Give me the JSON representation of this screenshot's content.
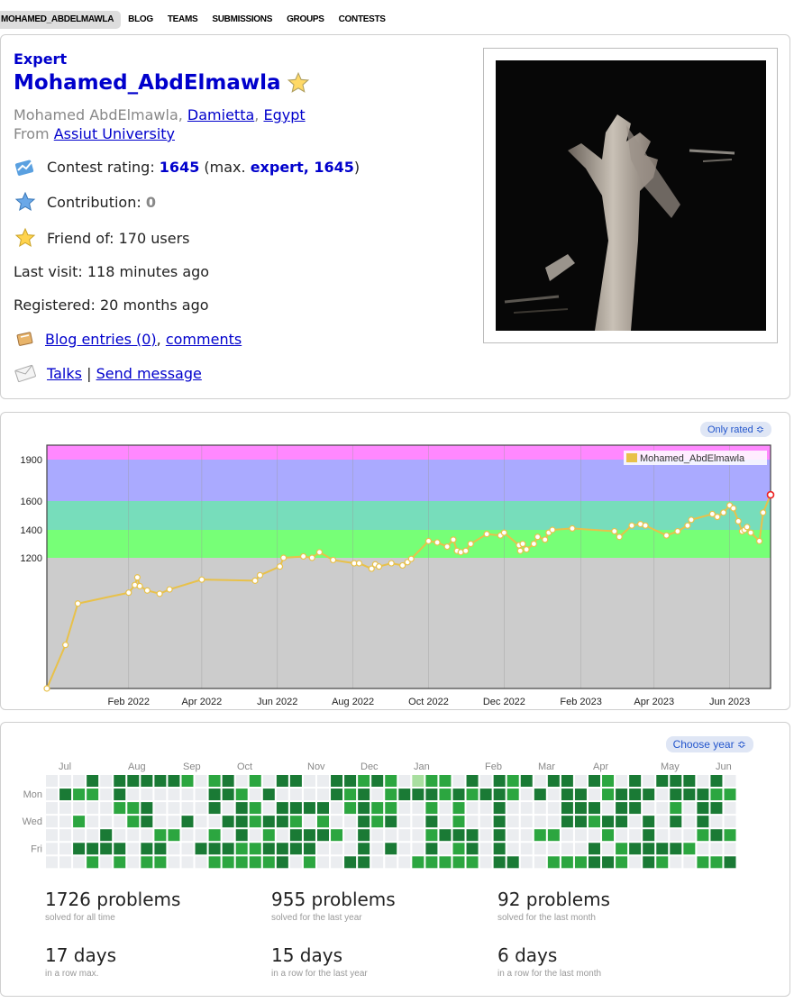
{
  "nav": {
    "items": [
      "MOHAMED_ABDELMAWLA",
      "BLOG",
      "TEAMS",
      "SUBMISSIONS",
      "GROUPS",
      "CONTESTS"
    ]
  },
  "profile": {
    "rank": "Expert",
    "handle": "Mohamed_AbdElmawla",
    "full_name": "Mohamed AbdElmawla",
    "city": "Damietta",
    "country": "Egypt",
    "from_label": "From",
    "organization": "Assiut University",
    "contest_rating_label": "Contest rating:",
    "contest_rating": "1645",
    "max_open": "(max.",
    "max_rank_value": "expert, 1645",
    "max_close": ")",
    "contribution_label": "Contribution:",
    "contribution": "0",
    "friend_of": "Friend of: 170 users",
    "last_visit": "Last visit: 118 minutes ago",
    "registered": "Registered: 20 months ago",
    "blog_entries": "Blog entries (0)",
    "comments": "comments",
    "talks": "Talks",
    "separator": "|",
    "send_message": "Send message"
  },
  "rating_graph": {
    "toggle_label": "Only rated ≎",
    "legend": "Mohamed_AbdElmawla"
  },
  "chart_data": {
    "type": "line",
    "title": "",
    "xlabel": "",
    "ylabel": "",
    "x_ticks": [
      "Feb 2022",
      "Apr 2022",
      "Jun 2022",
      "Aug 2022",
      "Oct 2022",
      "Dec 2022",
      "Feb 2023",
      "Apr 2023",
      "Jun 2023"
    ],
    "y_ticks": [
      1200,
      1400,
      1600,
      1900
    ],
    "ylim": [
      0,
      2000
    ],
    "bands": [
      {
        "from": 0,
        "to": 1200,
        "color": "#cccccc"
      },
      {
        "from": 1200,
        "to": 1400,
        "color": "#77ff77"
      },
      {
        "from": 1400,
        "to": 1600,
        "color": "#77ddbb"
      },
      {
        "from": 1600,
        "to": 1900,
        "color": "#aaaaff"
      },
      {
        "from": 1900,
        "to": 2000,
        "color": "#ff88ff"
      }
    ],
    "line_color": "#e8c14a",
    "series": [
      {
        "name": "Mohamed_AbdElmawla",
        "x": [
          "2021-11-27",
          "2021-12-12",
          "2021-12-22",
          "2022-02-01",
          "2022-02-06",
          "2022-02-08",
          "2022-02-10",
          "2022-02-16",
          "2022-02-26",
          "2022-03-06",
          "2022-04-01",
          "2022-05-14",
          "2022-05-18",
          "2022-06-03",
          "2022-06-06",
          "2022-06-22",
          "2022-06-29",
          "2022-07-05",
          "2022-07-16",
          "2022-08-02",
          "2022-08-06",
          "2022-08-16",
          "2022-08-19",
          "2022-08-22",
          "2022-09-01",
          "2022-09-10",
          "2022-09-14",
          "2022-09-17",
          "2022-10-01",
          "2022-10-08",
          "2022-10-16",
          "2022-10-21",
          "2022-10-24",
          "2022-10-27",
          "2022-10-31",
          "2022-11-04",
          "2022-11-17",
          "2022-11-28",
          "2022-12-01",
          "2022-12-13",
          "2022-12-14",
          "2022-12-16",
          "2022-12-19",
          "2022-12-25",
          "2022-12-28",
          "2023-01-03",
          "2023-01-06",
          "2023-01-09",
          "2023-01-25",
          "2023-02-28",
          "2023-03-04",
          "2023-03-14",
          "2023-03-21",
          "2023-03-25",
          "2023-04-11",
          "2023-04-20",
          "2023-04-28",
          "2023-05-01",
          "2023-05-18",
          "2023-05-22",
          "2023-05-27",
          "2023-06-01",
          "2023-06-04",
          "2023-06-08",
          "2023-06-11",
          "2023-06-13",
          "2023-06-15",
          "2023-06-18",
          "2023-06-25",
          "2023-06-28",
          "2023-07-04"
        ],
        "y": [
          0,
          400,
          780,
          880,
          950,
          1020,
          940,
          900,
          870,
          910,
          1000,
          990,
          1040,
          1120,
          1200,
          1210,
          1200,
          1240,
          1180,
          1150,
          1150,
          1100,
          1140,
          1120,
          1150,
          1130,
          1160,
          1190,
          1320,
          1310,
          1280,
          1330,
          1250,
          1240,
          1250,
          1300,
          1370,
          1360,
          1380,
          1290,
          1250,
          1300,
          1260,
          1300,
          1350,
          1330,
          1380,
          1400,
          1410,
          1390,
          1350,
          1430,
          1440,
          1430,
          1360,
          1390,
          1430,
          1470,
          1510,
          1490,
          1520,
          1570,
          1550,
          1460,
          1390,
          1400,
          1420,
          1380,
          1320,
          1520,
          1645
        ]
      }
    ]
  },
  "activity": {
    "choose_year": "Choose year ≎",
    "months": [
      "Jul",
      "Aug",
      "Sep",
      "Oct",
      "Nov",
      "Dec",
      "Jan",
      "Feb",
      "Mar",
      "Apr",
      "May",
      "Jun"
    ],
    "day_labels": [
      "Mon",
      "Wed",
      "Fri"
    ],
    "colors": [
      "#ebedf0",
      "#a9dfa0",
      "#2ca640",
      "#1a7a35"
    ],
    "weeks": [
      "0000000",
      "0300000",
      "0202030",
      "3200032",
      "0000330",
      "3320032",
      "3022000",
      "3033032",
      "3000232",
      "3000200",
      "2003000",
      "0000030",
      "2330232",
      "3303032",
      "0233322",
      "2022022",
      "0303232",
      "3033033",
      "3032330",
      "0030332",
      "0032300",
      "3300200",
      "3220003",
      "2333333",
      "3022000",
      "2223030",
      "0300000",
      "1300002",
      "2323232",
      "2200302",
      "0322322",
      "3200332",
      "0300000",
      "3333333",
      "2200003",
      "3000000",
      "0300200",
      "3000202",
      "3333002",
      "0333002",
      "3032033",
      "2203203",
      "0333022",
      "3330030",
      "0303333",
      "3000032",
      "3323030",
      "3300020",
      "0333202",
      "3230302",
      "0200203"
    ],
    "stats": [
      {
        "big": "1726 problems",
        "small": "solved for all time"
      },
      {
        "big": "955 problems",
        "small": "solved for the last year"
      },
      {
        "big": "92 problems",
        "small": "solved for the last month"
      },
      {
        "big": "17 days",
        "small": "in a row max."
      },
      {
        "big": "15 days",
        "small": "in a row for the last year"
      },
      {
        "big": "6 days",
        "small": "in a row for the last month"
      }
    ]
  }
}
